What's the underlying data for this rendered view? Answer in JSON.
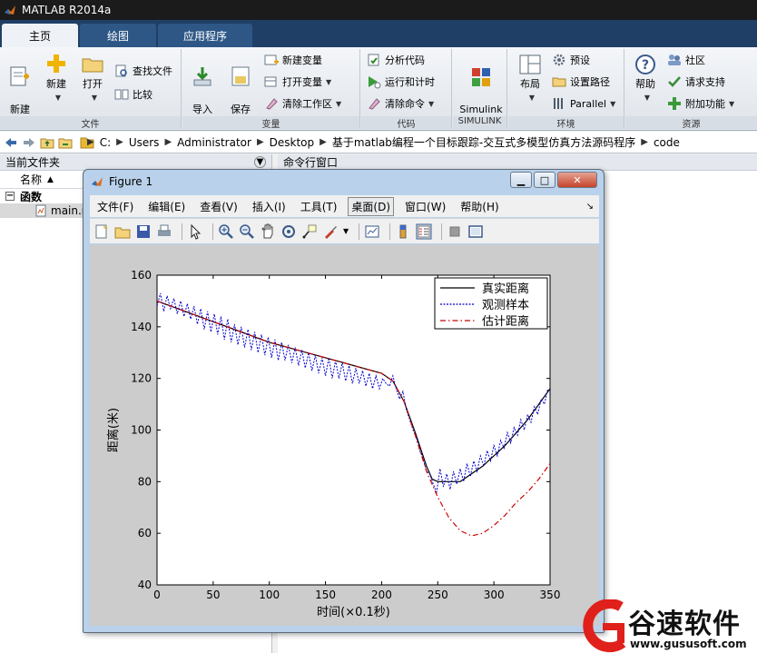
{
  "app": {
    "title": "MATLAB R2014a"
  },
  "tabs": [
    {
      "label": "主页"
    },
    {
      "label": "绘图"
    },
    {
      "label": "应用程序"
    }
  ],
  "ribbon": {
    "file_group": {
      "label": "文件",
      "new_script": "新建\n脚本",
      "new": "新建",
      "open": "打开",
      "find_files": "查找文件",
      "compare": "比较"
    },
    "variable_group": {
      "label": "变量",
      "import": "导入\n数据",
      "save_ws": "保存\n工作区",
      "new_var": "新建变量",
      "open_var": "打开变量",
      "clear_ws": "清除工作区"
    },
    "code_group": {
      "label": "代码",
      "analyze": "分析代码",
      "run_time": "运行和计时",
      "clear_cmds": "清除命令"
    },
    "simulink_group": {
      "label": "SIMULINK",
      "lib": "Simulink\n库"
    },
    "env_group": {
      "label": "环境",
      "layout": "布局",
      "prefs": "预设",
      "set_path": "设置路径",
      "parallel": "Parallel"
    },
    "resources_group": {
      "label": "资源",
      "help": "帮助",
      "community": "社区",
      "support": "请求支持",
      "addons": "附加功能"
    }
  },
  "address": {
    "crumbs": [
      "C:",
      "Users",
      "Administrator",
      "Desktop",
      "基于matlab编程一个目标跟踪-交互式多模型仿真方法源码程序",
      "code"
    ]
  },
  "current_folder": {
    "title": "当前文件夹",
    "col_name": "名称",
    "col_arrow": "▲",
    "group": "函数",
    "file": "main.m"
  },
  "command_window": {
    "title": "命令行窗口"
  },
  "figure": {
    "title": "Figure 1",
    "menu": [
      "文件(F)",
      "编辑(E)",
      "查看(V)",
      "插入(I)",
      "工具(T)",
      "桌面(D)",
      "窗口(W)",
      "帮助(H)"
    ],
    "selected_menu": 5
  },
  "chart_data": {
    "type": "line",
    "xlabel": "时间(×0.1秒)",
    "ylabel": "距离(米)",
    "xlim": [
      0,
      350
    ],
    "ylim": [
      40,
      160
    ],
    "xticks": [
      0,
      50,
      100,
      150,
      200,
      250,
      300,
      350
    ],
    "yticks": [
      40,
      60,
      80,
      100,
      120,
      140,
      160
    ],
    "grid": false,
    "legend_placement": "top-right",
    "series": [
      {
        "name": "真实距离",
        "color": "#000000",
        "style": "solid",
        "x": [
          0,
          25,
          50,
          75,
          100,
          125,
          150,
          175,
          200,
          210,
          220,
          230,
          240,
          245,
          250,
          260,
          270,
          280,
          290,
          300,
          310,
          320,
          330,
          340,
          350
        ],
        "y": [
          150,
          146,
          142,
          138,
          134,
          131,
          128,
          125,
          122,
          119,
          111,
          99,
          86,
          81,
          80,
          80,
          80,
          83,
          86,
          90,
          94,
          99,
          104,
          110,
          116
        ]
      },
      {
        "name": "观测样本",
        "color": "#0000cc",
        "style": "dotted",
        "x": [
          0,
          3,
          6,
          9,
          12,
          15,
          18,
          21,
          24,
          27,
          30,
          33,
          36,
          39,
          42,
          45,
          48,
          51,
          54,
          57,
          60,
          63,
          66,
          69,
          72,
          75,
          78,
          81,
          84,
          87,
          90,
          93,
          96,
          99,
          102,
          105,
          108,
          111,
          114,
          117,
          120,
          123,
          126,
          129,
          132,
          135,
          138,
          141,
          144,
          147,
          150,
          153,
          156,
          159,
          162,
          165,
          168,
          171,
          174,
          177,
          180,
          183,
          186,
          189,
          192,
          195,
          198,
          201,
          204,
          207,
          210,
          213,
          216,
          219,
          222,
          225,
          228,
          231,
          234,
          237,
          240,
          243,
          246,
          249,
          252,
          255,
          258,
          261,
          264,
          267,
          270,
          273,
          276,
          279,
          282,
          285,
          288,
          291,
          294,
          297,
          300,
          303,
          306,
          309,
          312,
          315,
          318,
          321,
          324,
          327,
          330,
          333,
          336,
          339,
          342,
          345,
          348
        ],
        "y": [
          148,
          153,
          146,
          152,
          147,
          151,
          145,
          150,
          144,
          149,
          143,
          148,
          141,
          147,
          139,
          146,
          138,
          145,
          137,
          144,
          135,
          143,
          134,
          141,
          133,
          140,
          132,
          139,
          131,
          138,
          130,
          137,
          129,
          136,
          128,
          135,
          127,
          134,
          127,
          133,
          126,
          132,
          125,
          131,
          124,
          130,
          123,
          129,
          122,
          128,
          121,
          128,
          120,
          127,
          120,
          126,
          119,
          125,
          118,
          124,
          118,
          123,
          117,
          122,
          116,
          121,
          116,
          120,
          118,
          117,
          121,
          116,
          112,
          115,
          108,
          104,
          100,
          97,
          92,
          89,
          84,
          83,
          79,
          76,
          85,
          78,
          83,
          77,
          84,
          79,
          85,
          80,
          87,
          82,
          88,
          84,
          90,
          86,
          92,
          88,
          94,
          90,
          96,
          93,
          99,
          95,
          101,
          98,
          104,
          100,
          106,
          103,
          109,
          106,
          112,
          110,
          116
        ]
      },
      {
        "name": "估计距离",
        "color": "#cc0000",
        "style": "dashdot",
        "x": [
          0,
          25,
          50,
          75,
          100,
          125,
          150,
          175,
          200,
          210,
          220,
          230,
          240,
          250,
          260,
          270,
          280,
          290,
          300,
          310,
          320,
          330,
          340,
          350
        ],
        "y": [
          150,
          146,
          142,
          138,
          134,
          131,
          128,
          125,
          122,
          119,
          111,
          98,
          84,
          74,
          66,
          61,
          59,
          60,
          63,
          67,
          72,
          76,
          81,
          87
        ]
      }
    ]
  },
  "watermark": {
    "text": "谷速软件",
    "url": "www.gususoft.com"
  },
  "colors": {
    "ribbon_tab_bg": "#1f3f66",
    "title_bg": "#1b1b1b",
    "figure_frame": "#b9d1ea",
    "plot_bg": "#cccccc",
    "watermark_red": "#e0201a"
  }
}
